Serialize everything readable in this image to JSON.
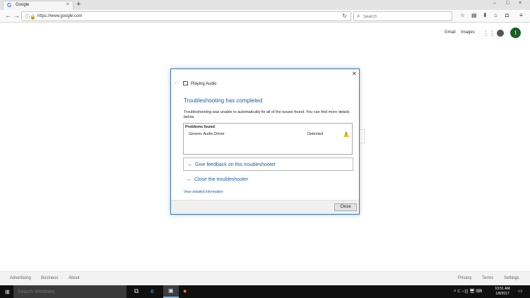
{
  "browser": {
    "tab_title": "Google",
    "tab_favicon": "G",
    "tab_close": "×",
    "new_tab": "+",
    "window_controls": [
      "–",
      "□",
      "×"
    ],
    "url": "https://www.google.com",
    "search_placeholder": "Search",
    "toolbar_icons": [
      "star-icon",
      "reader-icon",
      "download-icon",
      "home-icon",
      "pocket-icon",
      "menu-icon"
    ]
  },
  "google": {
    "gmail": "Gmail",
    "images": "Images",
    "avatar_letter": "t",
    "footer_left": [
      "Advertising",
      "Business",
      "About"
    ],
    "footer_right": [
      "Privacy",
      "Terms",
      "Settings"
    ]
  },
  "dialog": {
    "window_title": "Playing Audio",
    "heading": "Troubleshooting has completed",
    "message": "Troubleshooting was unable to automatically fix all of the issues found. You can find more details below.",
    "problems_header": "Problems found",
    "problem_name": "Generic Audio Driver",
    "problem_status": "Detected",
    "feedback_link": "Give feedback on this troubleshooter",
    "close_troubleshooter_link": "Close the troubleshooter",
    "details_link": "View detailed information",
    "close_button": "Close"
  },
  "taskbar": {
    "search_placeholder": "Search Windows",
    "time": "10:51 AM",
    "date": "1/8/2017",
    "accent": "#76b9ed"
  },
  "colors": {
    "dialog_border": "#2b7dbc",
    "link_blue": "#1a5fa8",
    "warning": "#f2c318"
  }
}
